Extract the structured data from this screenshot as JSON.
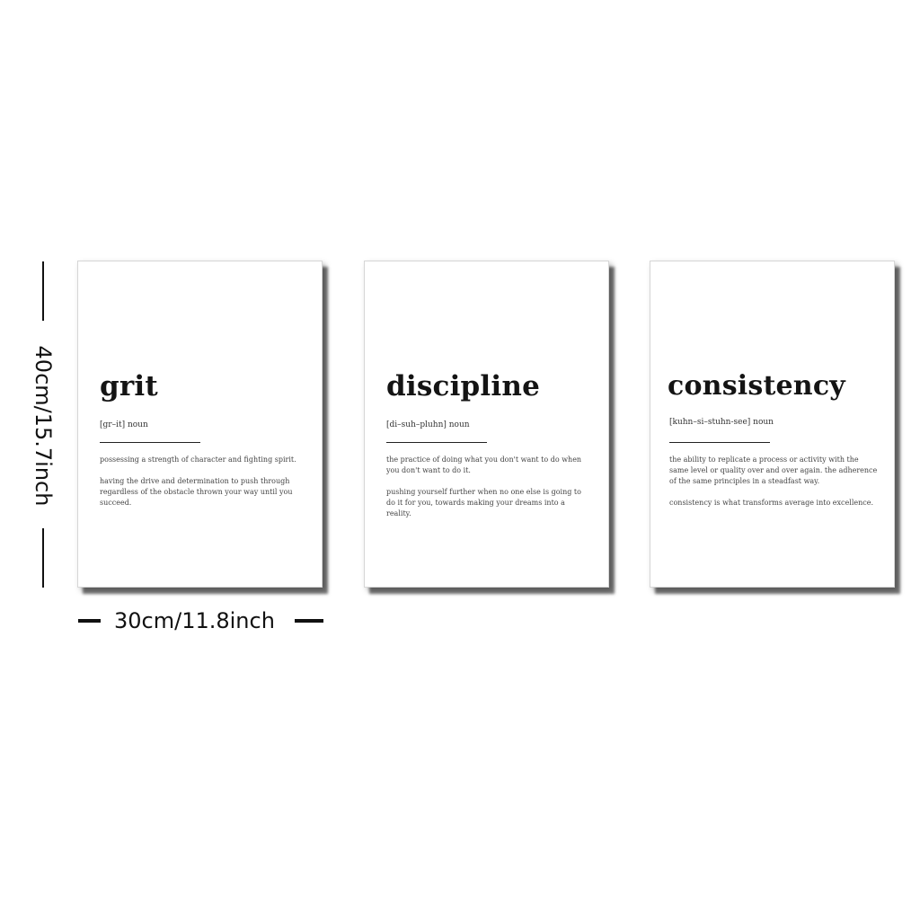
{
  "dimensions": {
    "height_label": "40cm/15.7inch",
    "width_label": "30cm/11.8inch"
  },
  "posters": [
    {
      "word": "grit",
      "pronunciation": "[gr–it] noun",
      "definitions": [
        "possessing a strength of character and fighting spirit.",
        "having the drive and determination to push through regardless of the obstacle thrown your way until you succeed."
      ]
    },
    {
      "word": "discipline",
      "pronunciation": "[di–suh–pluhn] noun",
      "definitions": [
        "the practice of doing what you don't want to do when you don't want to do it.",
        "pushing yourself further when no one else is going to do it for you, towards making your dreams into a reality."
      ]
    },
    {
      "word": "consistency",
      "pronunciation": "[kuhn–si–stuhn-see] noun",
      "definitions": [
        "the ability to replicate a process or activity with the same level or quality over and over again. the adherence of the same principles in a steadfast way.",
        "consistency is what transforms average into excellence."
      ]
    }
  ],
  "colors": {
    "background": "#ffffff",
    "ink": "#141414",
    "body_text": "#444444"
  }
}
